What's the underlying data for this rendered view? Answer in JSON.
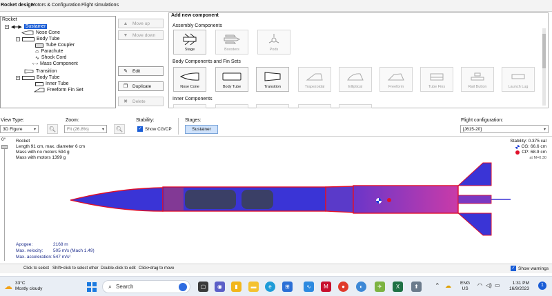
{
  "tabs": [
    "Rocket design",
    "Motors & Configuration",
    "Flight simulations"
  ],
  "tree": {
    "root": "Rocket",
    "items": [
      {
        "label": "Sustainer",
        "selected": true
      },
      {
        "label": "Nose Cone"
      },
      {
        "label": "Body Tube"
      },
      {
        "label": "Tube Coupler"
      },
      {
        "label": "Parachute"
      },
      {
        "label": "Shock Cord"
      },
      {
        "label": "Mass Component"
      },
      {
        "label": "Transition"
      },
      {
        "label": "Body Tube"
      },
      {
        "label": "Inner Tube"
      },
      {
        "label": "Freeform Fin Set"
      }
    ]
  },
  "actions": {
    "move_up": "Move up",
    "move_down": "Move down",
    "edit": "Edit",
    "duplicate": "Duplicate",
    "delete": "Delete"
  },
  "add_component": {
    "title": "Add new component",
    "assembly_title": "Assembly Components",
    "assembly": [
      "Stage",
      "Boosters",
      "Pods"
    ],
    "body_title": "Body Components and Fin Sets",
    "body": [
      "Nose Cone",
      "Body Tube",
      "Transition",
      "Trapezoidal",
      "Elliptical",
      "Freeform",
      "Tube Fins",
      "Rail Button",
      "Launch Lug"
    ],
    "inner_title": "Inner Components"
  },
  "controls": {
    "view_type_label": "View Type:",
    "view_type_value": "3D Figure",
    "zoom_label": "Zoom:",
    "zoom_value": "Fit (26.8%)",
    "stability_label": "Stability:",
    "show_cgcp": "Show CG/CP",
    "stages_label": "Stages:",
    "stage_button": "Sustainer",
    "flight_config_label": "Flight configuration:",
    "flight_config_value": "[J615-20]"
  },
  "figure": {
    "rotation": "0°",
    "info": {
      "name": "Rocket",
      "length": "Length 91 cm, max. diameter 6 cm",
      "mass_no_motors": "Mass with no motors 594 g",
      "mass_with_motors": "Mass with motors 1399 g"
    },
    "stability": {
      "line": "Stability: 0.375 cal",
      "cg": "CG: 66.6 cm",
      "cp": "CP: 68.9 cm",
      "mach": "at M=0.30"
    },
    "stats": {
      "apogee_label": "Apogee:",
      "apogee_value": "2168 m",
      "velocity_label": "Max. velocity:",
      "velocity_value": "505 m/s  (Mach 1.49)",
      "accel_label": "Max. acceleration:",
      "accel_value": "547 m/s²"
    },
    "colors": {
      "body": "#3a34d6",
      "outline": "#e0102a",
      "tail": "#b63db8"
    }
  },
  "statusbar": {
    "hints": [
      "Click to select",
      "Shift+click to select other",
      "Double-click to edit",
      "Click+drag to move"
    ],
    "show_warnings": "Show warnings"
  },
  "taskbar": {
    "weather_temp": "33°C",
    "weather_desc": "Mostly cloudy",
    "search_placeholder": "Search",
    "lang": "ENG",
    "region": "US",
    "time": "1:31 PM",
    "date": "16/9/2023"
  }
}
